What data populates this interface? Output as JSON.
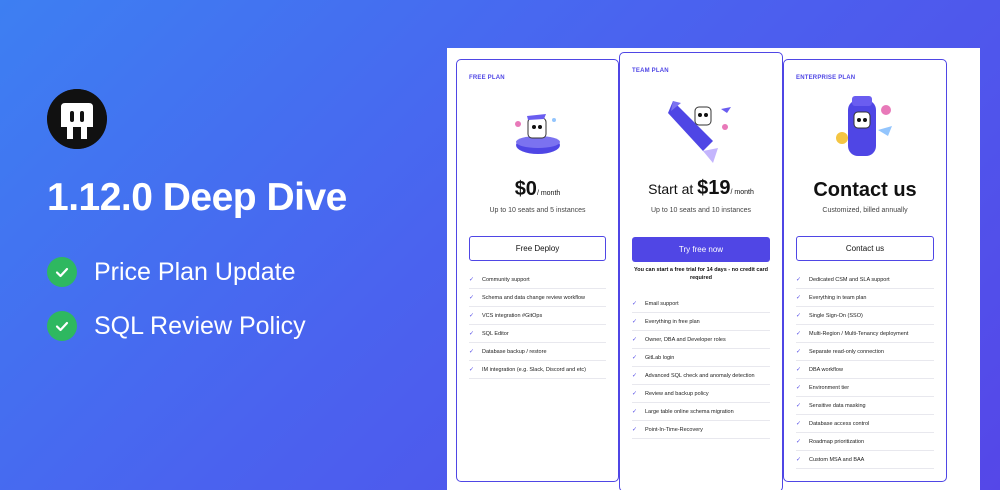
{
  "title": "1.12.0 Deep Dive",
  "features": [
    "Price Plan Update",
    "SQL Review Policy"
  ],
  "plans": [
    {
      "label": "FREE PLAN",
      "price_prefix": "",
      "price": "$0",
      "price_unit": "/ month",
      "subtitle": "Up to 10 seats and 5 instances",
      "button": "Free Deploy",
      "note": "",
      "items": [
        "Community support",
        "Schema and data change review workflow",
        "VCS integration #GitOps",
        "SQL Editor",
        "Database backup / restore",
        "IM integration (e.g. Slack, Discord and etc)"
      ]
    },
    {
      "label": "TEAM PLAN",
      "price_prefix": "Start at ",
      "price": "$19",
      "price_unit": "/ month",
      "subtitle": "Up to 10 seats and 10 instances",
      "button": "Try free now",
      "note": "You can start a free trial for 14 days - no credit card required",
      "items": [
        "Email support",
        "Everything in free plan",
        "Owner, DBA and Developer roles",
        "GitLab login",
        "Advanced SQL check and anomaly detection",
        "Review and backup policy",
        "Large table online schema migration",
        "Point-In-Time-Recovery"
      ]
    },
    {
      "label": "ENTERPRISE PLAN",
      "price_prefix": "",
      "price": "Contact us",
      "price_unit": "",
      "subtitle": "Customized, billed annually",
      "button": "Contact us",
      "note": "",
      "items": [
        "Dedicated CSM and SLA support",
        "Everything in team plan",
        "Single Sign-On (SSO)",
        "Multi-Region / Multi-Tenancy deployment",
        "Separate read-only connection",
        "DBA workflow",
        "Environment tier",
        "Sensitive data masking",
        "Database access control",
        "Roadmap prioritization",
        "Custom MSA and BAA"
      ]
    }
  ],
  "colors": {
    "accent": "#4f46e5",
    "check": "#2eb860"
  }
}
